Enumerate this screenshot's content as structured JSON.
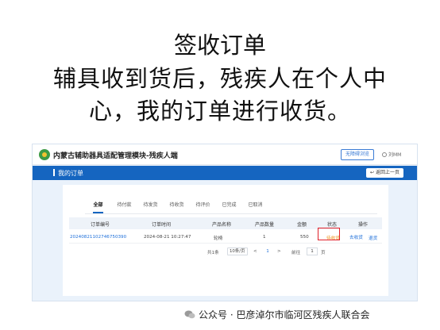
{
  "slide": {
    "line1": "签收订单",
    "line2": "辅具收到货后，残疾人在个人中",
    "line3": "心，我的订单进行收货。"
  },
  "app": {
    "title": "内蒙古辅助器具适配管理模块-残疾人端",
    "accessible_button": "无障碍浏览",
    "user_name": "刘MM"
  },
  "page_bar": {
    "title": "我的订单",
    "back_button": "返回上一页"
  },
  "tabs": [
    "全部",
    "待付款",
    "待发货",
    "待收货",
    "待评价",
    "已完成",
    "已取消"
  ],
  "table": {
    "columns": [
      "订单编号",
      "订单时间",
      "产品名称",
      "产品数量",
      "金额",
      "状态",
      "操作"
    ],
    "rows": [
      {
        "order_no": "20240821102746750390",
        "order_time": "2024-08-21 10:27:47",
        "product": "轮椅",
        "qty": "1",
        "amount": "550",
        "status": "待收货",
        "action_receive": "去收货",
        "action_other": "退货"
      }
    ]
  },
  "pager": {
    "total": "共1条",
    "page_size": "10条/页",
    "prev": "<",
    "current": "1",
    "next": ">",
    "goto_label": "前往",
    "goto_value": "1",
    "page_suffix": "页"
  },
  "footer": {
    "text": "公众号 · 巴彦淖尔市临河区残疾人联合会"
  },
  "colors": {
    "primary": "#1565c0",
    "highlight": "#e0202a",
    "status": "#f0901a"
  }
}
